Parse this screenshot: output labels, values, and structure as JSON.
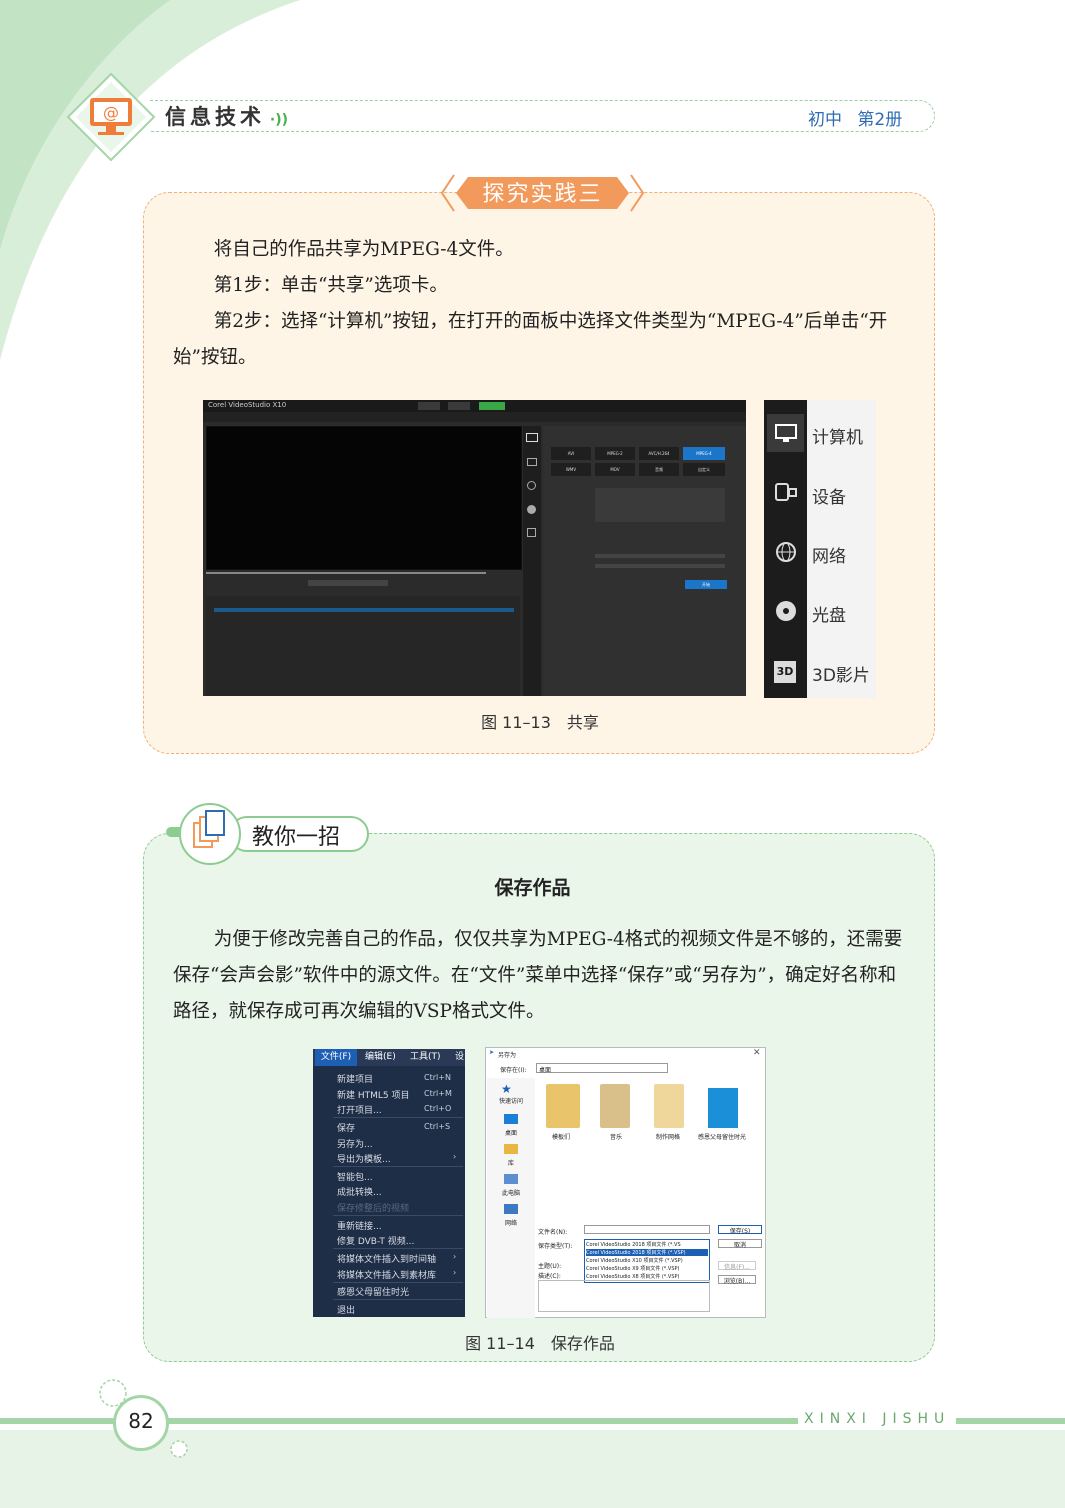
{
  "header": {
    "book_title": "信息技术",
    "edition": "初中 第2册"
  },
  "explore": {
    "tag": "探究实践三",
    "paragraphs": [
      "将自己的作品共享为MPEG-4文件。",
      "第1步：单击“共享”选项卡。",
      "第2步：选择“计算机”按钮，在打开的面板中选择文件类型为“MPEG-4”后单击“开始”按钮。"
    ],
    "screenshot": {
      "app_title": "Corel VideoStudio X10",
      "formats_row1": [
        "AVI",
        "MPEG-2",
        "AVC/H.264",
        "MPEG-4"
      ],
      "formats_row2": [
        "WMV",
        "MOV",
        "音频",
        "自定义"
      ],
      "start_button": "开始",
      "share_options": [
        "计算机",
        "设备",
        "网络",
        "光盘",
        "3D影片"
      ]
    },
    "caption": "图 11–13　共享"
  },
  "tips": {
    "tag": "教你一招",
    "section_title": "保存作品",
    "paragraph": "为便于修改完善自己的作品，仅仅共享为MPEG-4格式的视频文件是不够的，还需要保存“会声会影”软件中的源文件。在“文件”菜单中选择“保存”或“另存为”，确定好名称和路径，就保存成可再次编辑的VSP格式文件。",
    "file_menu": {
      "menubar": [
        "文件(F)",
        "编辑(E)",
        "工具(T)",
        "设"
      ],
      "items": [
        {
          "label": "新建项目",
          "key": "Ctrl+N"
        },
        {
          "label": "新建 HTML5 项目",
          "key": "Ctrl+M"
        },
        {
          "label": "打开项目...",
          "key": "Ctrl+O"
        },
        {
          "label": "保存",
          "key": "Ctrl+S"
        },
        {
          "label": "另存为...",
          "key": ""
        },
        {
          "label": "导出为模板...",
          "key": "›"
        },
        {
          "label": "智能包...",
          "key": ""
        },
        {
          "label": "成批转换...",
          "key": ""
        },
        {
          "label": "保存修整后的视频",
          "key": ""
        },
        {
          "label": "重新链接...",
          "key": ""
        },
        {
          "label": "修复 DVB-T 视频...",
          "key": ""
        },
        {
          "label": "将媒体文件插入到时间轴",
          "key": "›"
        },
        {
          "label": "将媒体文件插入到素材库",
          "key": "›"
        },
        {
          "label": "感恩父母留住时光",
          "key": ""
        },
        {
          "label": "退出",
          "key": ""
        }
      ]
    },
    "save_dialog": {
      "title": "另存为",
      "save_in_label": "保存在(I):",
      "save_in_value": "桌面",
      "places": [
        "快速访问",
        "桌面",
        "库",
        "此电脑",
        "网络"
      ],
      "files": [
        "模板们",
        "音乐",
        "制作网格",
        "感恩父母留住时光"
      ],
      "filename_label": "文件名(N):",
      "filetype_label": "保存类型(T):",
      "subject_label": "主题(U):",
      "desc_label": "描述(C):",
      "type_options": [
        "Corel VideoStudio 2018 项目文件 (*.VS",
        "Corel VideoStudio 2018 项目文件 (*.VSP)",
        "Corel VideoStudio X10 项目文件 (*.VSP)",
        "Corel VideoStudio X9 项目文件 (*.VSP)",
        "Corel VideoStudio X8 项目文件 (*.VSP)"
      ],
      "buttons": [
        "保存(S)",
        "取消",
        "信息(F)...",
        "浏览(B)..."
      ]
    },
    "caption": "图 11–14　保存作品"
  },
  "footer": {
    "page_number": "82",
    "series": "XINXI JISHU"
  },
  "colors": {
    "green": "#a3d5a6",
    "orange": "#f19a5c",
    "blue_text": "#2f6db3"
  }
}
